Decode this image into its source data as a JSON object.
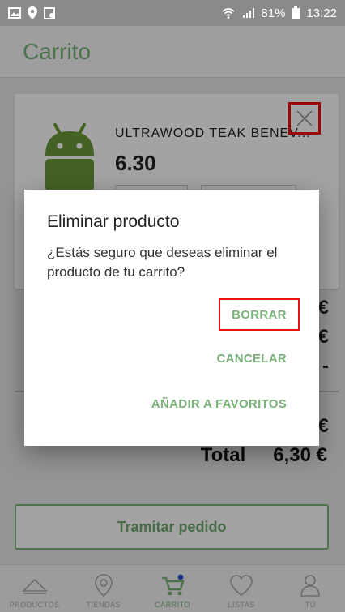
{
  "status_bar": {
    "battery": "81%",
    "time": "13:22"
  },
  "app_bar": {
    "title": "Carrito"
  },
  "cart": {
    "product_name": "ULTRAWOOD TEAK BENEV...",
    "product_price": "6.30",
    "summary_lines": [
      "€",
      "€",
      "-",
      "€"
    ],
    "total_label": "Total",
    "total_value": "6,30 €",
    "checkout_label": "Tramitar pedido"
  },
  "dialog": {
    "title": "Eliminar producto",
    "message": "¿Estás seguro que deseas eliminar el producto de tu carrito?",
    "delete_label": "BORRAR",
    "cancel_label": "CANCELAR",
    "favorite_label": "AÑADIR A FAVORITOS"
  },
  "bottom_nav": {
    "items": [
      {
        "label": "PRODUCTOS",
        "icon": "products-icon"
      },
      {
        "label": "TIENDAS",
        "icon": "location-icon"
      },
      {
        "label": "CARRITO",
        "icon": "cart-icon"
      },
      {
        "label": "LISTAS",
        "icon": "heart-icon"
      },
      {
        "label": "TÚ",
        "icon": "profile-icon"
      }
    ],
    "active_index": 2
  },
  "colors": {
    "accent": "#7ab27a",
    "highlight": "#e11111"
  }
}
